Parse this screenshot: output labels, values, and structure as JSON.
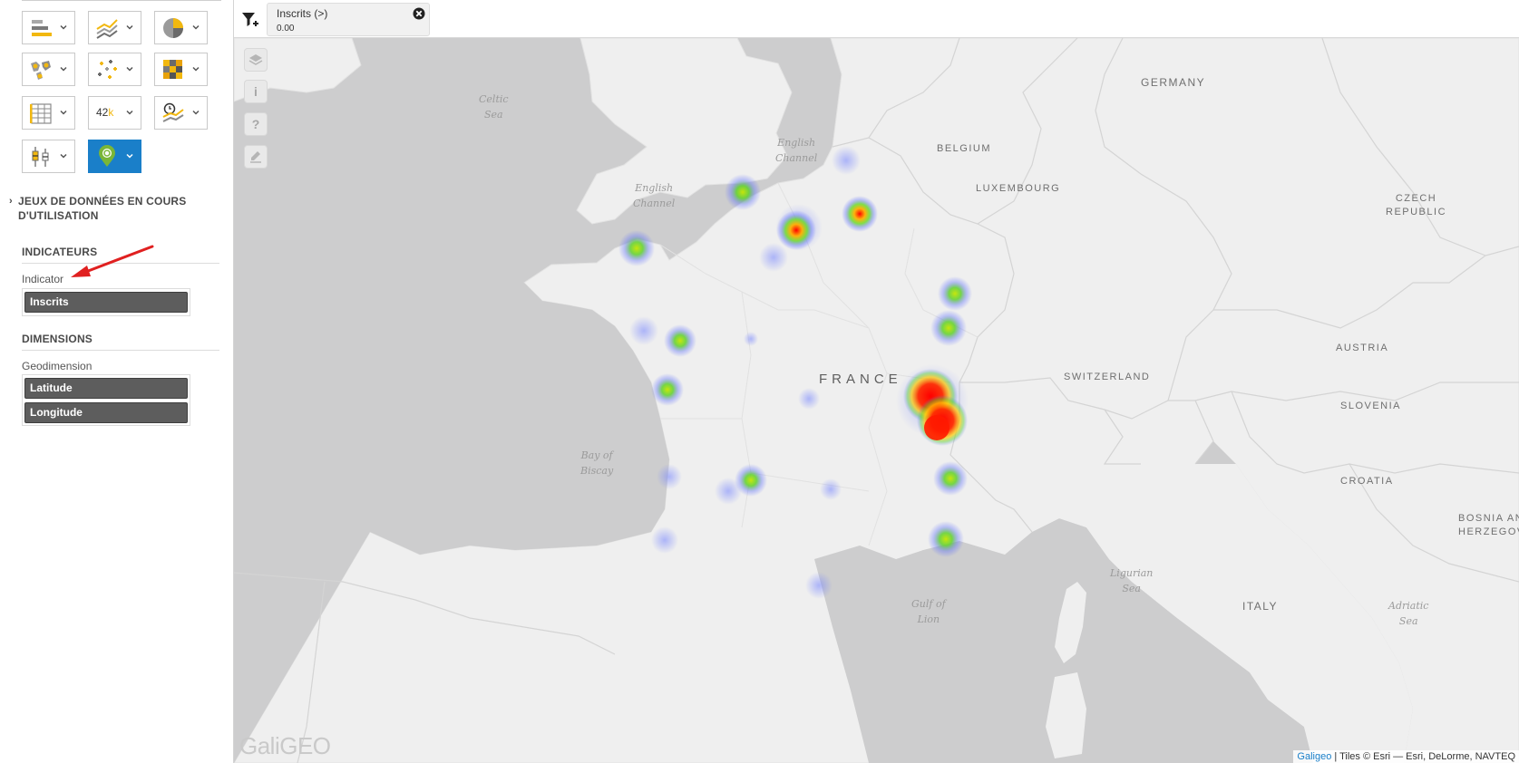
{
  "sidebar": {
    "chart_types": [
      {
        "icon": "bar-chart-icon",
        "active": false
      },
      {
        "icon": "line-chart-icon",
        "active": false
      },
      {
        "icon": "pie-chart-icon",
        "active": false
      },
      {
        "icon": "map-chart-icon",
        "active": false
      },
      {
        "icon": "scatter-chart-icon",
        "active": false
      },
      {
        "icon": "heatmap-grid-icon",
        "active": false
      },
      {
        "icon": "table-icon",
        "active": false
      },
      {
        "icon": "kpi-icon",
        "active": false,
        "label": "42",
        "label_suffix": "k"
      },
      {
        "icon": "timeline-chart-icon",
        "active": false
      },
      {
        "icon": "boxplot-icon",
        "active": false
      },
      {
        "icon": "geo-marker-icon",
        "active": true
      }
    ],
    "datasets_toggle": {
      "line1": "JEUX DE DONNÉES EN COURS",
      "line2": "D'UTILISATION"
    },
    "indicators": {
      "title": "INDICATEURS",
      "label": "Indicator",
      "items": [
        "Inscrits"
      ]
    },
    "dimensions": {
      "title": "DIMENSIONS",
      "label": "Geodimension",
      "items": [
        "Latitude",
        "Longitude"
      ]
    }
  },
  "filterbar": {
    "chip_name": "Inscrits (>)",
    "chip_value": "0.00"
  },
  "map": {
    "tools": [
      "layers-icon",
      "info-icon",
      "help-icon",
      "draw-icon"
    ],
    "tool_labels": {
      "info": "i",
      "help": "?"
    },
    "labels": {
      "germany": "GERMANY",
      "belgium": "BELGIUM",
      "luxembourg": "LUXEMBOURG",
      "france": "FRANCE",
      "switzerland": "SWITZERLAND",
      "austria": "AUSTRIA",
      "czech1": "CZECH",
      "czech2": "REPUBLIC",
      "slovenia": "SLOVENIA",
      "croatia": "CROATIA",
      "bosnia1": "BOSNIA AN",
      "bosnia2": "HERZEGOV",
      "italy": "ITALY",
      "celtic1": "Celtic",
      "celtic2": "Sea",
      "ch1a": "English",
      "ch1b": "Channel",
      "ch2a": "English",
      "ch2b": "Channel",
      "biscay1": "Bay of",
      "biscay2": "Biscay",
      "ligurian1": "Ligurian",
      "ligurian2": "Sea",
      "lion1": "Gulf of",
      "lion2": "Lion",
      "adriatic1": "Adriatic",
      "adriatic2": "Sea"
    },
    "logo": "GaliGEO",
    "attribution_link": "Galigeo",
    "attribution_text": " | Tiles © Esri — Esri, DeLorme, NAVTEQ",
    "heat_points": [
      {
        "name": "Lyon",
        "intensity": 1.0
      },
      {
        "name": "Grenoble",
        "intensity": 0.95
      },
      {
        "name": "Paris",
        "intensity": 0.9
      },
      {
        "name": "Reims",
        "intensity": 0.75
      },
      {
        "name": "Avignon",
        "intensity": 0.45
      },
      {
        "name": "Marseille",
        "intensity": 0.4
      },
      {
        "name": "Rouen",
        "intensity": 0.35
      },
      {
        "name": "Rennes",
        "intensity": 0.3
      },
      {
        "name": "Nancy",
        "intensity": 0.3
      },
      {
        "name": "Dijon",
        "intensity": 0.35
      },
      {
        "name": "Poitiers",
        "intensity": 0.25
      },
      {
        "name": "La Rochelle",
        "intensity": 0.22
      },
      {
        "name": "Toulouse",
        "intensity": 0.25
      },
      {
        "name": "Agen",
        "intensity": 0.15
      }
    ]
  }
}
